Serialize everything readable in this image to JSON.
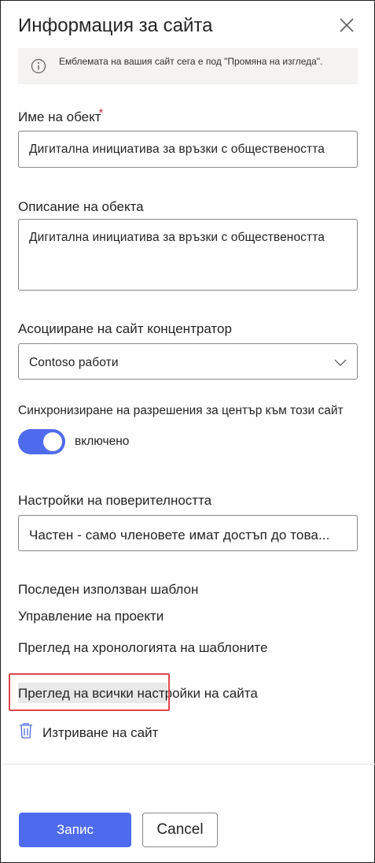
{
  "panel": {
    "title": "Информация за сайта",
    "info_message": "Емблемата на вашия сайт сега е под \"Промяна на изгледа\"."
  },
  "site_name": {
    "label": "Име на обект",
    "required_mark": "*",
    "value": "Дигитална инициатива за връзки с обществеността"
  },
  "site_description": {
    "label": "Описание на обекта",
    "value": "Дигитална инициатива за връзки с обществеността"
  },
  "hub_association": {
    "label": "Асоцииране на сайт концентратор",
    "selected": "Contoso работи"
  },
  "permission_sync": {
    "label": "Синхронизиране на разрешения за център към този сайт",
    "state_label": "включено",
    "enabled": true
  },
  "privacy": {
    "label": "Настройки на поверителността",
    "selected": "Частен - само членовете имат достъп до това..."
  },
  "template": {
    "label": "Последен използван шаблон",
    "value": "Управление на проекти",
    "history_link": "Преглед на хронологията на шаблоните"
  },
  "all_settings_link": "Преглед на всички настройки на сайта",
  "delete_site_label": "Изтриване на сайт",
  "footer": {
    "save_label": "Запис",
    "cancel_label": "Cancel"
  },
  "colors": {
    "accent": "#4f6bed",
    "required": "#c4314b",
    "highlight_border": "#e0464f"
  },
  "icons": {
    "close": "close-icon",
    "info": "info-icon",
    "chevron": "chevron-down-icon",
    "delete": "trash-icon"
  }
}
